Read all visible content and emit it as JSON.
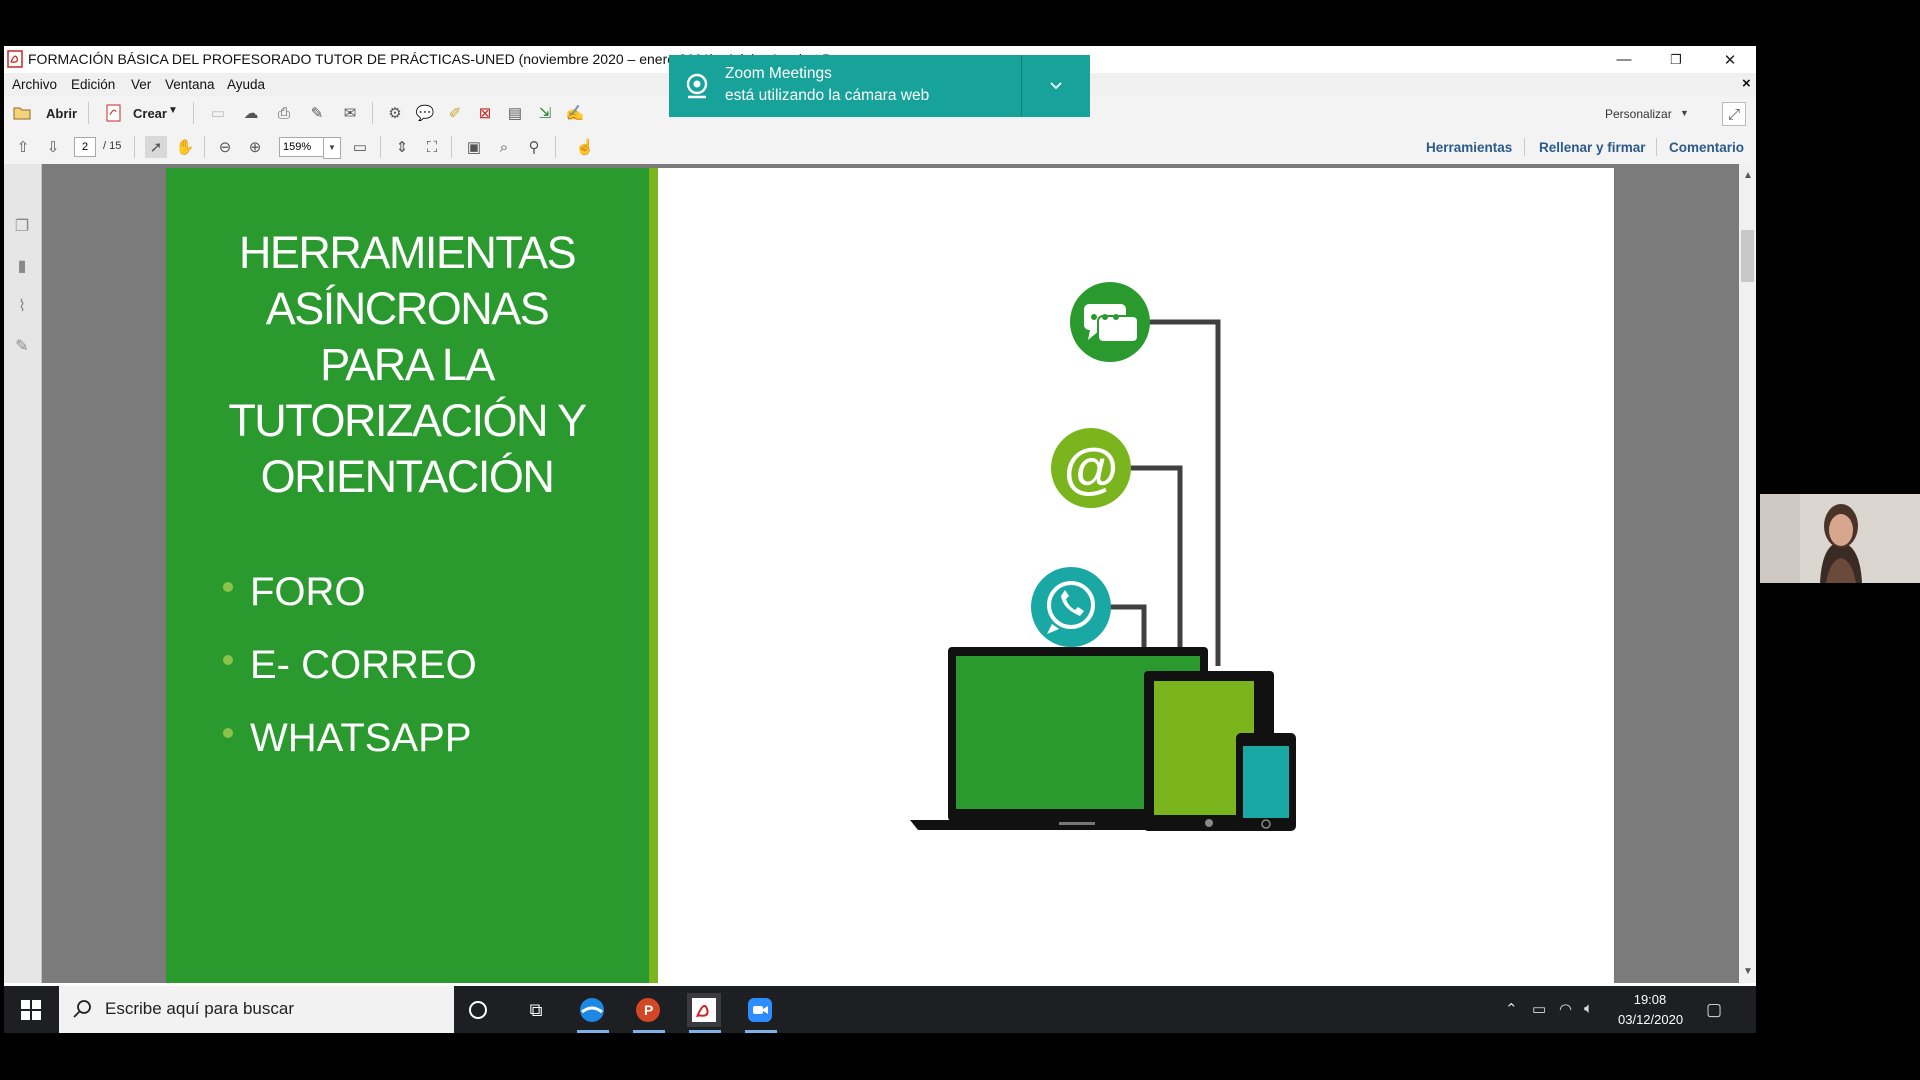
{
  "window": {
    "title": "FORMACIÓN BÁSICA DEL PROFESORADO TUTOR DE PRÁCTICAS-UNED (noviembre 2020 – enero  2021) - Adobe Acrobat Pro",
    "minimize": "—",
    "restore": "❐",
    "close": "✕"
  },
  "menu": {
    "items": [
      "Archivo",
      "Edición",
      "Ver",
      "Ventana",
      "Ayuda"
    ],
    "close_x": "×"
  },
  "toolbar1": {
    "open_label": "Abrir",
    "create_label": "Crear",
    "customize_label": "Personalizar"
  },
  "toolbar2": {
    "page_current": "2",
    "page_total": "/ 15",
    "zoom": "159%",
    "links": [
      "Herramientas",
      "Rellenar y firmar",
      "Comentario"
    ]
  },
  "zoom_notification": {
    "app": "Zoom Meetings",
    "message": "está utilizando la cámara web"
  },
  "slide": {
    "title": "HERRAMIENTAS\nASÍNCRONAS\nPARA LA\nTUTORIZACIÓN Y\nORIENTACIÓN",
    "bullets": [
      "FORO",
      "E- CORREO",
      "WHATSAPP"
    ],
    "at_symbol": "@",
    "colors": {
      "dark_green": "#2a9a2e",
      "light_green": "#7ab51d",
      "teal": "#1aa8a4"
    }
  },
  "taskbar": {
    "search_placeholder": "Escribe aquí para buscar",
    "time": "19:08",
    "date": "03/12/2020"
  }
}
